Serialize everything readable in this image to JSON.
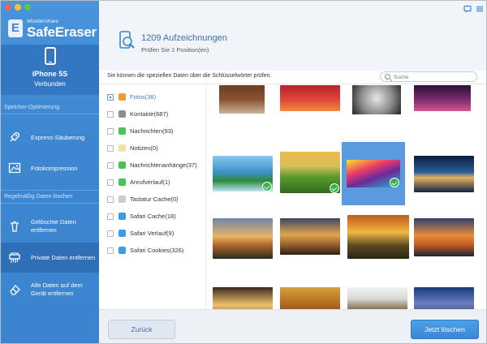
{
  "app": {
    "brand_small": "Wondershare",
    "brand_name": "SafeEraser"
  },
  "device": {
    "name": "iPhone 5S",
    "status": "Verbunden"
  },
  "sidebar": {
    "section1": "Speicher-Optimierung",
    "section2": "Regelmäßig Daten löschen",
    "items": [
      {
        "label": "Express-Säuberung",
        "icon": "rocket-icon"
      },
      {
        "label": "Fotokompression",
        "icon": "photo-icon"
      },
      {
        "label": "Gelöschte Daten entfernen",
        "icon": "trash-icon"
      },
      {
        "label": "Private Daten entfernen",
        "icon": "shredder-icon",
        "active": true
      },
      {
        "label": "Alle Daten auf dem Gerät entfernen",
        "icon": "eraser-icon"
      }
    ]
  },
  "header": {
    "records_count": "1209 Aufzeichnungen",
    "sub_prefix": "Prüfen Sie",
    "sub_count": "3",
    "sub_suffix": "Position(en)"
  },
  "toolbar": {
    "hint": "Sie können die speziellen Daten über die Schlüsselwörter prüfen.",
    "search_placeholder": "Suche"
  },
  "categories": [
    {
      "label": "Fotos(38)",
      "icon": "photos-icon",
      "color": "#f29a3a",
      "state": "partial",
      "active": true
    },
    {
      "label": "Kontakte(687)",
      "icon": "contacts-icon",
      "color": "#8a8f96",
      "state": "unchecked"
    },
    {
      "label": "Nachrichten(93)",
      "icon": "messages-icon",
      "color": "#4cc35a",
      "state": "unchecked"
    },
    {
      "label": "Notizen(0)",
      "icon": "notes-icon",
      "color": "#f3e3a0",
      "state": "unchecked"
    },
    {
      "label": "Nachrichtenanhänge(37)",
      "icon": "attachment-icon",
      "color": "#4cc35a",
      "state": "unchecked"
    },
    {
      "label": "Anrufverlauf(1)",
      "icon": "phone-icon",
      "color": "#4cc35a",
      "state": "unchecked"
    },
    {
      "label": "Tastatur Cache(0)",
      "icon": "keyboard-icon",
      "color": "#c9ced4",
      "state": "unchecked"
    },
    {
      "label": "Safari Cache(18)",
      "icon": "safari-icon",
      "color": "#3b9be8",
      "state": "unchecked"
    },
    {
      "label": "Safari Verlauf(9)",
      "icon": "safari-icon",
      "color": "#3b9be8",
      "state": "unchecked"
    },
    {
      "label": "Safari Cookies(326)",
      "icon": "safari-icon",
      "color": "#3b9be8",
      "state": "unchecked"
    }
  ],
  "photos": [
    {
      "name": "daisies",
      "bg": "linear-gradient(#6b3d22,#8a5230 50%,#c9b49a)",
      "checked": false,
      "selected": false
    },
    {
      "name": "red-autumn-tree",
      "bg": "linear-gradient(#b8222a,#e0453a 55%,#f08a3c)",
      "checked": false,
      "selected": false
    },
    {
      "name": "sketch-portrait",
      "bg": "radial-gradient(circle at 50% 45%,#e6e6e6,#8a8a8a 55%,#222)",
      "checked": false,
      "selected": false
    },
    {
      "name": "purple-night",
      "bg": "linear-gradient(#2a0f3a,#7a2b6e 55%,#d3588c)",
      "checked": false,
      "selected": false
    },
    {
      "name": "lake-mountains",
      "bg": "linear-gradient(#8cc7ee,#3c93c9 45%,#2f8a3e 70%,#bfe4f4)",
      "checked": true,
      "selected": false
    },
    {
      "name": "green-meadow-tree",
      "bg": "linear-gradient(#f0b84a,#d5c15a 35%,#5c9b2e 60%,#2e6a1c)",
      "checked": true,
      "selected": false
    },
    {
      "name": "abstract-paint",
      "bg": "linear-gradient(160deg,#ffe12a,#e83a6a 35%,#6a2a9a 60%,#23b9c9)",
      "checked": true,
      "selected": true
    },
    {
      "name": "dusk-lake",
      "bg": "linear-gradient(#0c1d3a,#2b5e9c 45%,#e8b062 60%,#0e2442)",
      "checked": false,
      "selected": false
    },
    {
      "name": "sunset-tree",
      "bg": "linear-gradient(#6e86a8,#e8b266 45%,#b36a2e 65%,#2c2a22)",
      "checked": false,
      "selected": false
    },
    {
      "name": "golden-pier",
      "bg": "linear-gradient(#3d4662,#e2a44c 45%,#8e5a2a 75%,#2a1f15)",
      "checked": false,
      "selected": false
    },
    {
      "name": "lone-tree",
      "bg": "linear-gradient(#c25a1c,#f0b640 40%,#5a4a22 70%,#2a2610)",
      "checked": false,
      "selected": false
    },
    {
      "name": "orange-sea",
      "bg": "linear-gradient(#2f3f6e,#e88e3a 45%,#c45a22 70%,#162238)",
      "checked": false,
      "selected": false
    },
    {
      "name": "forest-rays",
      "bg": "linear-gradient(#3a2a20,#f0c26a 55%,#6a4a2a)",
      "checked": false,
      "selected": false
    },
    {
      "name": "autumn-road",
      "bg": "linear-gradient(#d4a23a,#b56a22 50%,#6a3a1a)",
      "checked": false,
      "selected": false
    },
    {
      "name": "railway-text",
      "bg": "linear-gradient(#f2f2f2,#d9d9d9 35%,#8a7a5a 65%,#4a3a22)",
      "checked": false,
      "selected": false
    },
    {
      "name": "night-sky",
      "bg": "linear-gradient(#1a3a7a,#6b7fc4 50%,#2a2a4a)",
      "checked": false,
      "selected": false
    }
  ],
  "footer": {
    "back_label": "Zurück",
    "delete_label": "Jetzt löschen"
  }
}
